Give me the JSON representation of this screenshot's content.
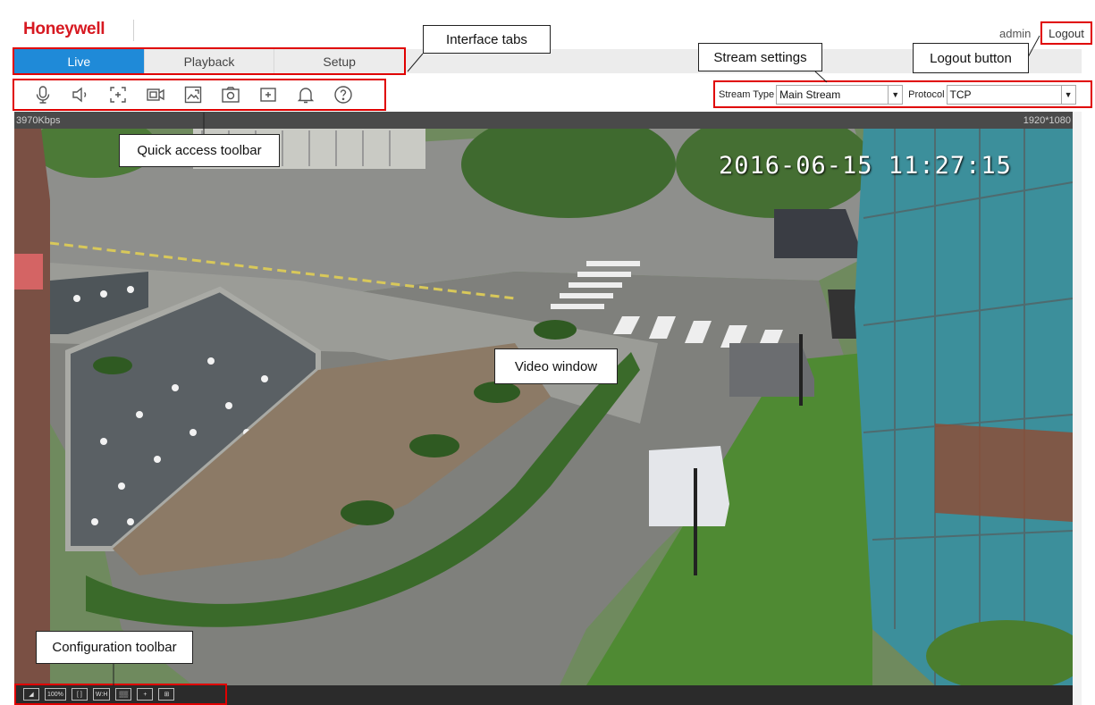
{
  "brand": {
    "logo_text": "Honeywell",
    "logo_color": "#d71921"
  },
  "header": {
    "user": "admin",
    "logout_label": "Logout"
  },
  "tabs": [
    {
      "label": "Live",
      "active": true
    },
    {
      "label": "Playback",
      "active": false
    },
    {
      "label": "Setup",
      "active": false
    }
  ],
  "toolbar": {
    "icons": [
      "microphone-icon",
      "speaker-icon",
      "digital-zoom-icon",
      "record-icon",
      "snapshot-image-icon",
      "camera-capture-icon",
      "add-window-icon",
      "alarm-bell-icon",
      "help-icon"
    ]
  },
  "stream": {
    "type_label": "Stream Type",
    "type_value": "Main Stream",
    "protocol_label": "Protocol",
    "protocol_value": "TCP"
  },
  "video": {
    "bitrate": "3970Kbps",
    "resolution": "1920*1080",
    "timestamp": "2016-06-15 11:27:15"
  },
  "config_toolbar": {
    "icons": [
      {
        "name": "fit-window-icon",
        "text": "◢"
      },
      {
        "name": "original-size-icon",
        "text": "100%"
      },
      {
        "name": "fullscreen-icon",
        "text": "[ ]"
      },
      {
        "name": "aspect-ratio-icon",
        "text": "W:H"
      },
      {
        "name": "image-adjust-icon",
        "text": "▒▒"
      },
      {
        "name": "ptz-icon",
        "text": "+"
      },
      {
        "name": "zoom-region-icon",
        "text": "⊞"
      }
    ]
  },
  "callouts": {
    "interface_tabs": "Interface tabs",
    "stream_settings": "Stream settings",
    "logout_button": "Logout button",
    "quick_access": "Quick access toolbar",
    "video_window": "Video window",
    "config_toolbar": "Configuration toolbar"
  },
  "colors": {
    "active_tab": "#1f8ad8",
    "highlight": "#e00000"
  }
}
